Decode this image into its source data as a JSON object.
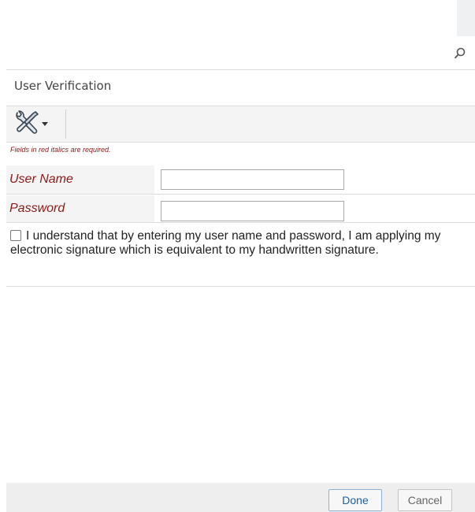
{
  "window": {
    "icons": {
      "search": "search-icon",
      "tools": "tools-icon",
      "dropdown": "caret-down-icon"
    }
  },
  "dialog": {
    "title": "User Verification",
    "required_note": "Fields in red italics are required.",
    "fields": {
      "user_name": {
        "label": "User Name",
        "value": ""
      },
      "password": {
        "label": "Password",
        "value": ""
      }
    },
    "acknowledgement": {
      "checked": false,
      "text": "I understand that by entering my user name and password, I am applying my electronic signature which is equivalent to my handwritten signature."
    },
    "buttons": {
      "done": "Done",
      "cancel": "Cancel"
    }
  },
  "colors": {
    "required_label": "#8b1a1a",
    "panel_bg": "#f4f4f4",
    "primary_button_text": "#1f5fa0",
    "primary_button_border": "#8db2d4"
  }
}
